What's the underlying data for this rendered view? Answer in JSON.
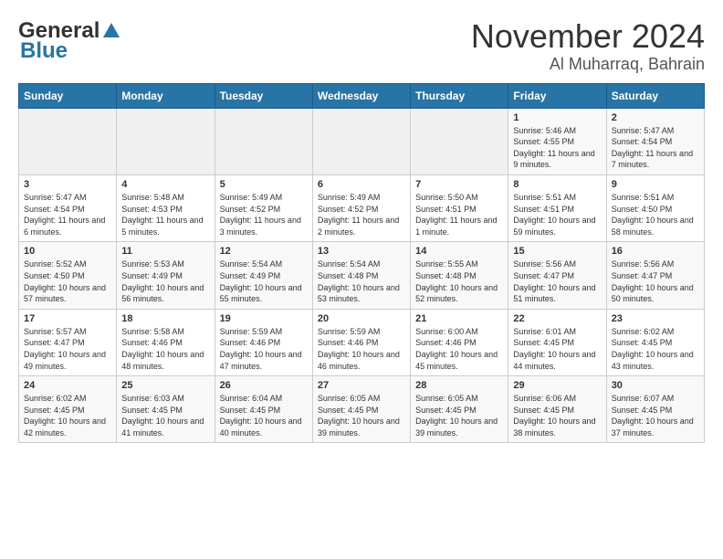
{
  "header": {
    "logo_general": "General",
    "logo_blue": "Blue",
    "title": "November 2024",
    "subtitle": "Al Muharraq, Bahrain"
  },
  "weekdays": [
    "Sunday",
    "Monday",
    "Tuesday",
    "Wednesday",
    "Thursday",
    "Friday",
    "Saturday"
  ],
  "weeks": [
    [
      {
        "day": "",
        "empty": true
      },
      {
        "day": "",
        "empty": true
      },
      {
        "day": "",
        "empty": true
      },
      {
        "day": "",
        "empty": true
      },
      {
        "day": "",
        "empty": true
      },
      {
        "day": "1",
        "sunrise": "5:46 AM",
        "sunset": "4:55 PM",
        "daylight": "11 hours and 9 minutes."
      },
      {
        "day": "2",
        "sunrise": "5:47 AM",
        "sunset": "4:54 PM",
        "daylight": "11 hours and 7 minutes."
      }
    ],
    [
      {
        "day": "3",
        "sunrise": "5:47 AM",
        "sunset": "4:54 PM",
        "daylight": "11 hours and 6 minutes."
      },
      {
        "day": "4",
        "sunrise": "5:48 AM",
        "sunset": "4:53 PM",
        "daylight": "11 hours and 5 minutes."
      },
      {
        "day": "5",
        "sunrise": "5:49 AM",
        "sunset": "4:52 PM",
        "daylight": "11 hours and 3 minutes."
      },
      {
        "day": "6",
        "sunrise": "5:49 AM",
        "sunset": "4:52 PM",
        "daylight": "11 hours and 2 minutes."
      },
      {
        "day": "7",
        "sunrise": "5:50 AM",
        "sunset": "4:51 PM",
        "daylight": "11 hours and 1 minute."
      },
      {
        "day": "8",
        "sunrise": "5:51 AM",
        "sunset": "4:51 PM",
        "daylight": "10 hours and 59 minutes."
      },
      {
        "day": "9",
        "sunrise": "5:51 AM",
        "sunset": "4:50 PM",
        "daylight": "10 hours and 58 minutes."
      }
    ],
    [
      {
        "day": "10",
        "sunrise": "5:52 AM",
        "sunset": "4:50 PM",
        "daylight": "10 hours and 57 minutes."
      },
      {
        "day": "11",
        "sunrise": "5:53 AM",
        "sunset": "4:49 PM",
        "daylight": "10 hours and 56 minutes."
      },
      {
        "day": "12",
        "sunrise": "5:54 AM",
        "sunset": "4:49 PM",
        "daylight": "10 hours and 55 minutes."
      },
      {
        "day": "13",
        "sunrise": "5:54 AM",
        "sunset": "4:48 PM",
        "daylight": "10 hours and 53 minutes."
      },
      {
        "day": "14",
        "sunrise": "5:55 AM",
        "sunset": "4:48 PM",
        "daylight": "10 hours and 52 minutes."
      },
      {
        "day": "15",
        "sunrise": "5:56 AM",
        "sunset": "4:47 PM",
        "daylight": "10 hours and 51 minutes."
      },
      {
        "day": "16",
        "sunrise": "5:56 AM",
        "sunset": "4:47 PM",
        "daylight": "10 hours and 50 minutes."
      }
    ],
    [
      {
        "day": "17",
        "sunrise": "5:57 AM",
        "sunset": "4:47 PM",
        "daylight": "10 hours and 49 minutes."
      },
      {
        "day": "18",
        "sunrise": "5:58 AM",
        "sunset": "4:46 PM",
        "daylight": "10 hours and 48 minutes."
      },
      {
        "day": "19",
        "sunrise": "5:59 AM",
        "sunset": "4:46 PM",
        "daylight": "10 hours and 47 minutes."
      },
      {
        "day": "20",
        "sunrise": "5:59 AM",
        "sunset": "4:46 PM",
        "daylight": "10 hours and 46 minutes."
      },
      {
        "day": "21",
        "sunrise": "6:00 AM",
        "sunset": "4:46 PM",
        "daylight": "10 hours and 45 minutes."
      },
      {
        "day": "22",
        "sunrise": "6:01 AM",
        "sunset": "4:45 PM",
        "daylight": "10 hours and 44 minutes."
      },
      {
        "day": "23",
        "sunrise": "6:02 AM",
        "sunset": "4:45 PM",
        "daylight": "10 hours and 43 minutes."
      }
    ],
    [
      {
        "day": "24",
        "sunrise": "6:02 AM",
        "sunset": "4:45 PM",
        "daylight": "10 hours and 42 minutes."
      },
      {
        "day": "25",
        "sunrise": "6:03 AM",
        "sunset": "4:45 PM",
        "daylight": "10 hours and 41 minutes."
      },
      {
        "day": "26",
        "sunrise": "6:04 AM",
        "sunset": "4:45 PM",
        "daylight": "10 hours and 40 minutes."
      },
      {
        "day": "27",
        "sunrise": "6:05 AM",
        "sunset": "4:45 PM",
        "daylight": "10 hours and 39 minutes."
      },
      {
        "day": "28",
        "sunrise": "6:05 AM",
        "sunset": "4:45 PM",
        "daylight": "10 hours and 39 minutes."
      },
      {
        "day": "29",
        "sunrise": "6:06 AM",
        "sunset": "4:45 PM",
        "daylight": "10 hours and 38 minutes."
      },
      {
        "day": "30",
        "sunrise": "6:07 AM",
        "sunset": "4:45 PM",
        "daylight": "10 hours and 37 minutes."
      }
    ]
  ],
  "labels": {
    "sunrise": "Sunrise:",
    "sunset": "Sunset:",
    "daylight": "Daylight:"
  }
}
